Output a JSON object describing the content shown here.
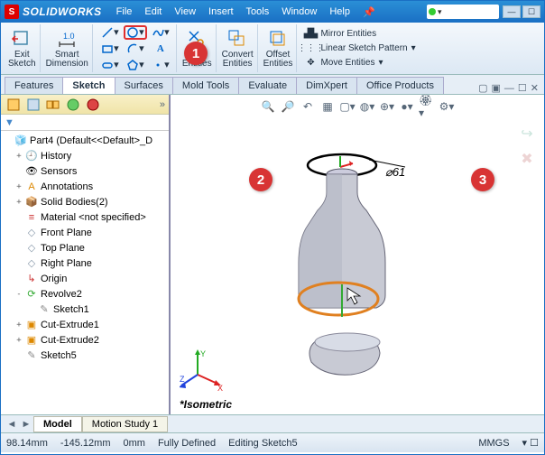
{
  "title": {
    "brand": "SOLIDWORKS"
  },
  "menu": [
    "File",
    "Edit",
    "View",
    "Insert",
    "Tools",
    "Window",
    "Help"
  ],
  "ribbon": {
    "exit_sketch": "Exit\nSketch",
    "smart_dimension": "Smart\nDimension",
    "trim": "Trim\nEntities",
    "convert": "Convert\nEntities",
    "offset": "Offset\nEntities",
    "mirror": "Mirror Entities",
    "linear": "Linear Sketch Pattern",
    "move": "Move Entities"
  },
  "cmd_tabs": [
    "Features",
    "Sketch",
    "Surfaces",
    "Mold Tools",
    "Evaluate",
    "DimXpert",
    "Office Products"
  ],
  "active_cmd_tab": "Sketch",
  "tree": {
    "root": "Part4  (Default<<Default>_D",
    "items": [
      {
        "icon": "history",
        "label": "History",
        "exp": "+",
        "depth": 1
      },
      {
        "icon": "sensors",
        "label": "Sensors",
        "exp": "",
        "depth": 1
      },
      {
        "icon": "annot",
        "label": "Annotations",
        "exp": "+",
        "depth": 1
      },
      {
        "icon": "solid",
        "label": "Solid Bodies(2)",
        "exp": "+",
        "depth": 1
      },
      {
        "icon": "material",
        "label": "Material <not specified>",
        "exp": "",
        "depth": 1
      },
      {
        "icon": "plane",
        "label": "Front Plane",
        "exp": "",
        "depth": 1
      },
      {
        "icon": "plane",
        "label": "Top Plane",
        "exp": "",
        "depth": 1
      },
      {
        "icon": "plane",
        "label": "Right Plane",
        "exp": "",
        "depth": 1
      },
      {
        "icon": "origin",
        "label": "Origin",
        "exp": "",
        "depth": 1
      },
      {
        "icon": "revolve",
        "label": "Revolve2",
        "exp": "-",
        "depth": 1
      },
      {
        "icon": "sketch",
        "label": "Sketch1",
        "exp": "",
        "depth": 2
      },
      {
        "icon": "cut",
        "label": "Cut-Extrude1",
        "exp": "+",
        "depth": 1
      },
      {
        "icon": "cut",
        "label": "Cut-Extrude2",
        "exp": "+",
        "depth": 1
      },
      {
        "icon": "sketch",
        "label": "Sketch5",
        "exp": "",
        "depth": 1
      }
    ]
  },
  "dimension": "⌀61",
  "view_label": "*Isometric",
  "bottom_tabs": [
    "Model",
    "Motion Study 1"
  ],
  "status": {
    "x": "98.14mm",
    "y": "-145.12mm",
    "z": "0mm",
    "state": "Fully Defined",
    "context": "Editing Sketch5",
    "units": "MMGS"
  },
  "callouts": {
    "c1": "1",
    "c2": "2",
    "c3": "3"
  }
}
